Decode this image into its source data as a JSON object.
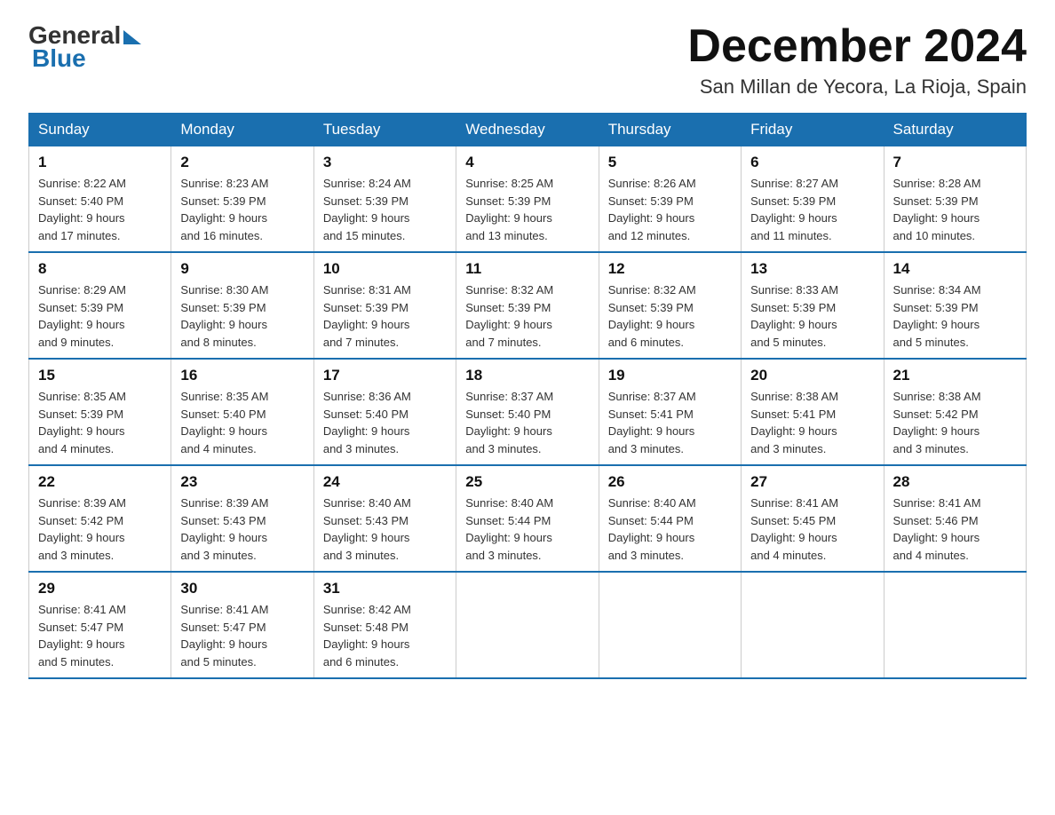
{
  "header": {
    "logo_general": "General",
    "logo_blue": "Blue",
    "month_title": "December 2024",
    "location": "San Millan de Yecora, La Rioja, Spain"
  },
  "days_of_week": [
    "Sunday",
    "Monday",
    "Tuesday",
    "Wednesday",
    "Thursday",
    "Friday",
    "Saturday"
  ],
  "weeks": [
    [
      {
        "day": "1",
        "sunrise": "8:22 AM",
        "sunset": "5:40 PM",
        "daylight": "9 hours and 17 minutes."
      },
      {
        "day": "2",
        "sunrise": "8:23 AM",
        "sunset": "5:39 PM",
        "daylight": "9 hours and 16 minutes."
      },
      {
        "day": "3",
        "sunrise": "8:24 AM",
        "sunset": "5:39 PM",
        "daylight": "9 hours and 15 minutes."
      },
      {
        "day": "4",
        "sunrise": "8:25 AM",
        "sunset": "5:39 PM",
        "daylight": "9 hours and 13 minutes."
      },
      {
        "day": "5",
        "sunrise": "8:26 AM",
        "sunset": "5:39 PM",
        "daylight": "9 hours and 12 minutes."
      },
      {
        "day": "6",
        "sunrise": "8:27 AM",
        "sunset": "5:39 PM",
        "daylight": "9 hours and 11 minutes."
      },
      {
        "day": "7",
        "sunrise": "8:28 AM",
        "sunset": "5:39 PM",
        "daylight": "9 hours and 10 minutes."
      }
    ],
    [
      {
        "day": "8",
        "sunrise": "8:29 AM",
        "sunset": "5:39 PM",
        "daylight": "9 hours and 9 minutes."
      },
      {
        "day": "9",
        "sunrise": "8:30 AM",
        "sunset": "5:39 PM",
        "daylight": "9 hours and 8 minutes."
      },
      {
        "day": "10",
        "sunrise": "8:31 AM",
        "sunset": "5:39 PM",
        "daylight": "9 hours and 7 minutes."
      },
      {
        "day": "11",
        "sunrise": "8:32 AM",
        "sunset": "5:39 PM",
        "daylight": "9 hours and 7 minutes."
      },
      {
        "day": "12",
        "sunrise": "8:32 AM",
        "sunset": "5:39 PM",
        "daylight": "9 hours and 6 minutes."
      },
      {
        "day": "13",
        "sunrise": "8:33 AM",
        "sunset": "5:39 PM",
        "daylight": "9 hours and 5 minutes."
      },
      {
        "day": "14",
        "sunrise": "8:34 AM",
        "sunset": "5:39 PM",
        "daylight": "9 hours and 5 minutes."
      }
    ],
    [
      {
        "day": "15",
        "sunrise": "8:35 AM",
        "sunset": "5:39 PM",
        "daylight": "9 hours and 4 minutes."
      },
      {
        "day": "16",
        "sunrise": "8:35 AM",
        "sunset": "5:40 PM",
        "daylight": "9 hours and 4 minutes."
      },
      {
        "day": "17",
        "sunrise": "8:36 AM",
        "sunset": "5:40 PM",
        "daylight": "9 hours and 3 minutes."
      },
      {
        "day": "18",
        "sunrise": "8:37 AM",
        "sunset": "5:40 PM",
        "daylight": "9 hours and 3 minutes."
      },
      {
        "day": "19",
        "sunrise": "8:37 AM",
        "sunset": "5:41 PM",
        "daylight": "9 hours and 3 minutes."
      },
      {
        "day": "20",
        "sunrise": "8:38 AM",
        "sunset": "5:41 PM",
        "daylight": "9 hours and 3 minutes."
      },
      {
        "day": "21",
        "sunrise": "8:38 AM",
        "sunset": "5:42 PM",
        "daylight": "9 hours and 3 minutes."
      }
    ],
    [
      {
        "day": "22",
        "sunrise": "8:39 AM",
        "sunset": "5:42 PM",
        "daylight": "9 hours and 3 minutes."
      },
      {
        "day": "23",
        "sunrise": "8:39 AM",
        "sunset": "5:43 PM",
        "daylight": "9 hours and 3 minutes."
      },
      {
        "day": "24",
        "sunrise": "8:40 AM",
        "sunset": "5:43 PM",
        "daylight": "9 hours and 3 minutes."
      },
      {
        "day": "25",
        "sunrise": "8:40 AM",
        "sunset": "5:44 PM",
        "daylight": "9 hours and 3 minutes."
      },
      {
        "day": "26",
        "sunrise": "8:40 AM",
        "sunset": "5:44 PM",
        "daylight": "9 hours and 3 minutes."
      },
      {
        "day": "27",
        "sunrise": "8:41 AM",
        "sunset": "5:45 PM",
        "daylight": "9 hours and 4 minutes."
      },
      {
        "day": "28",
        "sunrise": "8:41 AM",
        "sunset": "5:46 PM",
        "daylight": "9 hours and 4 minutes."
      }
    ],
    [
      {
        "day": "29",
        "sunrise": "8:41 AM",
        "sunset": "5:47 PM",
        "daylight": "9 hours and 5 minutes."
      },
      {
        "day": "30",
        "sunrise": "8:41 AM",
        "sunset": "5:47 PM",
        "daylight": "9 hours and 5 minutes."
      },
      {
        "day": "31",
        "sunrise": "8:42 AM",
        "sunset": "5:48 PM",
        "daylight": "9 hours and 6 minutes."
      },
      null,
      null,
      null,
      null
    ]
  ],
  "labels": {
    "sunrise": "Sunrise:",
    "sunset": "Sunset:",
    "daylight": "Daylight:"
  }
}
